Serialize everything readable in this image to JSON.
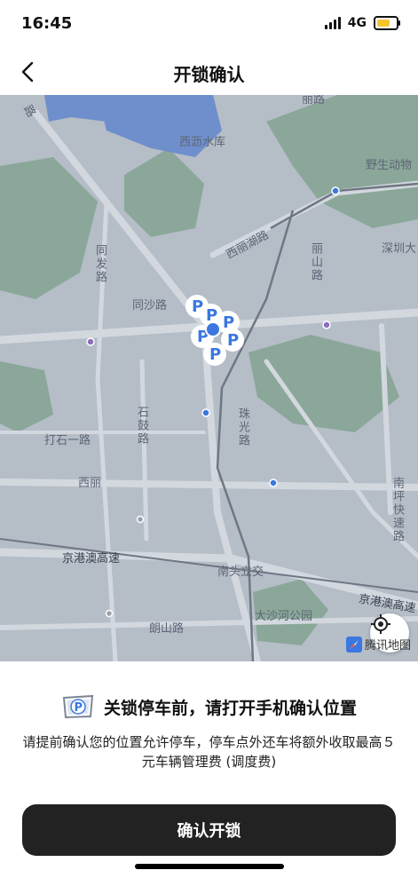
{
  "status_bar": {
    "time": "16:45",
    "network": "4G"
  },
  "nav": {
    "title": "开锁确认"
  },
  "map": {
    "labels": {
      "reservoir": "西沥水库",
      "wildlife": "野生动物",
      "xili_lake_road": "西丽湖路",
      "shenzhen": "深圳大",
      "lishan_road": "丽山路",
      "tongfa_road": "同发路",
      "tongsha_road": "同沙路",
      "shigu_road": "石鼓路",
      "dashiyi_road": "打石一路",
      "zhuguang_road": "珠光路",
      "xili": "西丽",
      "nanping": "南坪快速路",
      "jinggangao_left": "京港澳高速",
      "jinggangao_right": "京港澳高速",
      "nantou": "南头立交",
      "dashahe": "大沙河公园",
      "langshan_road": "朗山路",
      "top_road": "路",
      "top_right": "丽路"
    },
    "brand": "腾讯地图",
    "colors": {
      "land": "#b5bdc7",
      "green": "#8aa79a",
      "water": "#6f8fcc",
      "road": "#d3d8df",
      "marker": "#3a78e0"
    }
  },
  "sheet": {
    "headline": "关锁停车前，请打开手机确认位置",
    "description": "请提前确认您的位置允许停车，停车点外还车将额外收取最高５元车辆管理费 (调度费)",
    "confirm_label": "确认开锁",
    "badge_letter": "P"
  }
}
